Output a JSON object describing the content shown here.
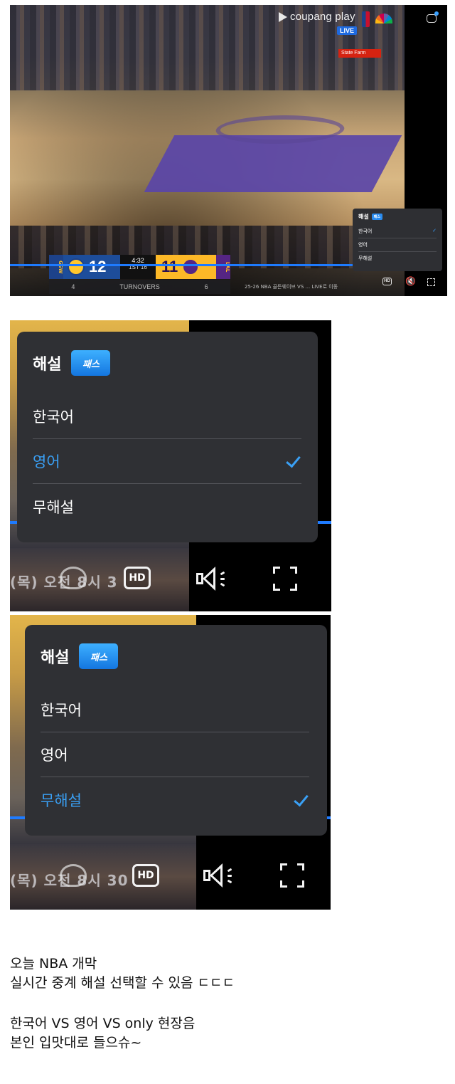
{
  "player": {
    "brand": "coupang play",
    "live_badge": "LIVE",
    "sponsor": "State Farm",
    "scoreboard": {
      "home_abbr": "GSW",
      "home_score": "12",
      "clock": "4:32",
      "period": "1ST",
      "shot_clock": "16",
      "away_score": "11",
      "away_abbr": "LAL",
      "stat_label": "TURNOVERS",
      "home_stat": "4",
      "away_stat": "6"
    },
    "ticker": "25-26 NBA 골든웨이브 VS ... LIVE로 이동",
    "hd_label": "HD",
    "menu": {
      "title": "해설",
      "pass_badge": "패스",
      "options": [
        "한국어",
        "영어",
        "무해설"
      ],
      "selected": "한국어"
    }
  },
  "zoom_panels": [
    {
      "title": "해설",
      "pass_badge": "패스",
      "options": [
        "한국어",
        "영어",
        "무해설"
      ],
      "selected": "영어",
      "ticker": "(목) 오전 8시 3",
      "hd_label": "HD"
    },
    {
      "title": "해설",
      "pass_badge": "패스",
      "options": [
        "한국어",
        "영어",
        "무해설"
      ],
      "selected": "무해설",
      "ticker": "(목) 오전 8시 30",
      "hd_label": "HD"
    }
  ],
  "caption": {
    "line1": "오늘 NBA 개막",
    "line2": "실시간 중계 해설 선택할 수 있음 ㄷㄷㄷ",
    "line3": "한국어 VS 영어 VS only 현장음",
    "line4": "본인 입맛대로 들으슈~"
  },
  "colors": {
    "accent_blue": "#3aa0f5",
    "menu_bg": "#2f3034",
    "progress_blue": "#1e7bff"
  }
}
